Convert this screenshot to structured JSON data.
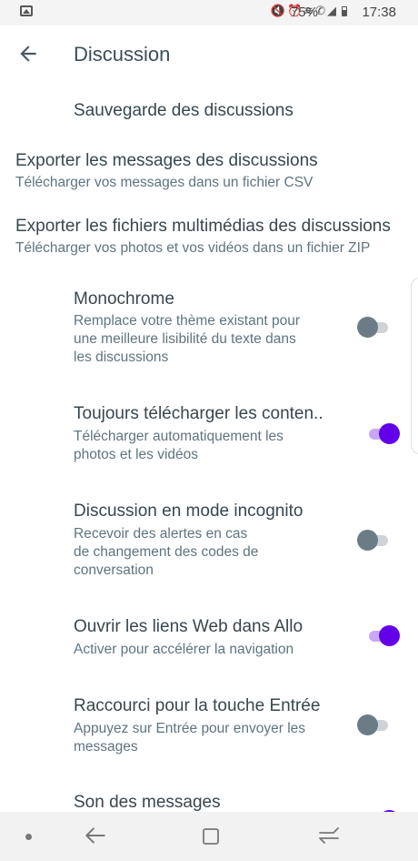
{
  "status_bar": {
    "battery_percent": "75%",
    "time": "17:38",
    "icons": [
      "gallery-icon",
      "mute-icon",
      "alarm-icon",
      "wifi-icon",
      "call-icon",
      "signal-icon",
      "battery-icon"
    ]
  },
  "app_bar": {
    "title": "Discussion",
    "back_icon": "back-arrow-icon"
  },
  "section": {
    "header": "Sauvegarde des discussions"
  },
  "export_items": [
    {
      "title": "Exporter les messages des discussions",
      "subtitle": "Télécharger vos messages dans un fichier CSV"
    },
    {
      "title": "Exporter les fichiers multimédias des discussions",
      "subtitle": "Télécharger vos photos et vos vidéos dans un fichier ZIP"
    }
  ],
  "settings": [
    {
      "title": "Monochrome",
      "subtitle_lines": [
        "Remplace votre thème existant pour",
        "une meilleure lisibilité du texte dans",
        "les discussions"
      ],
      "enabled": false
    },
    {
      "title": "Toujours télécharger les conten..",
      "subtitle_lines": [
        "Télécharger automatiquement les",
        "photos et les vidéos"
      ],
      "enabled": true
    },
    {
      "title": "Discussion en mode incognito",
      "subtitle_lines": [
        "Recevoir des alertes en cas",
        "de changement des codes de",
        "conversation"
      ],
      "enabled": false
    },
    {
      "title": "Ouvrir les liens Web dans Allo",
      "subtitle_lines": [
        "Activer pour accélérer la navigation"
      ],
      "enabled": true
    },
    {
      "title": "Raccourci pour la touche Entrée",
      "subtitle_lines": [
        "Appuyez sur Entrée pour envoyer les",
        "messages"
      ],
      "enabled": false
    },
    {
      "title": "Son des messages",
      "subtitle_lines": [],
      "enabled": true
    }
  ],
  "colors": {
    "accent": "#6200ea",
    "accent_track": "#c8a8f4",
    "off_thumb": "#6b7c86",
    "off_track": "#cfd3d6",
    "text_primary": "#37474f",
    "text_secondary": "#5f7480"
  },
  "nav_bar": {
    "icons": [
      "dot-icon",
      "back-icon",
      "recents-icon",
      "home-icon"
    ]
  }
}
